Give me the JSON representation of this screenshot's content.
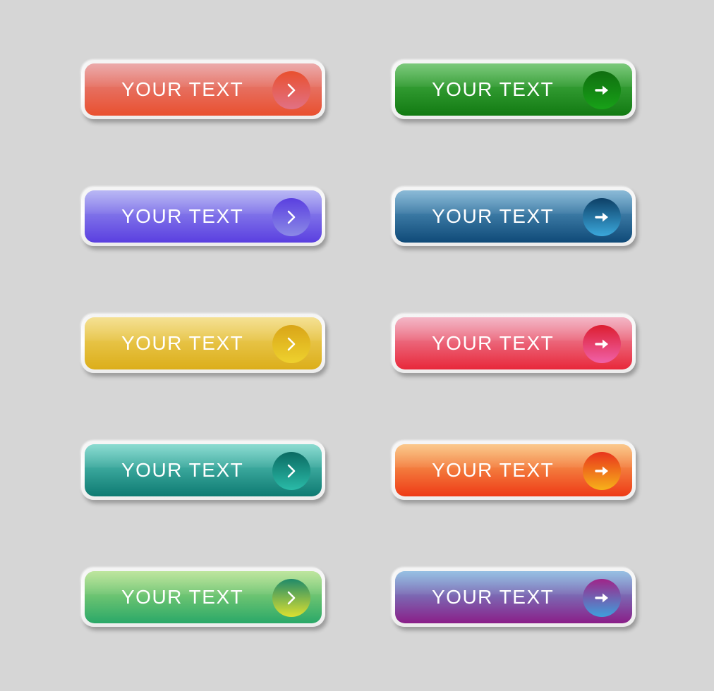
{
  "background": "#d6d6d6",
  "buttons": [
    {
      "label": "YOUR TEXT",
      "icon": "chevron-right",
      "top": "#e48a8a",
      "bottom": "#e9502f",
      "circle_top": "#e9502f",
      "circle_bottom": "#e17185"
    },
    {
      "label": "YOUR TEXT",
      "icon": "arrow-right",
      "top": "#4ab54a",
      "bottom": "#127a12",
      "circle_top": "#0f6e0f",
      "circle_bottom": "#18a118"
    },
    {
      "label": "YOUR TEXT",
      "icon": "chevron-right",
      "top": "#9e9cf0",
      "bottom": "#5a3fe0",
      "circle_top": "#5a3fe0",
      "circle_bottom": "#8b8ae6"
    },
    {
      "label": "YOUR TEXT",
      "icon": "arrow-right",
      "top": "#5fa0c8",
      "bottom": "#0f4a78",
      "circle_top": "#0d3f66",
      "circle_bottom": "#3ba8dc"
    },
    {
      "label": "YOUR TEXT",
      "icon": "chevron-right",
      "top": "#f0d56a",
      "bottom": "#dcae1a",
      "circle_top": "#d9a518",
      "circle_bottom": "#eed12e"
    },
    {
      "label": "YOUR TEXT",
      "icon": "arrow-right",
      "top": "#ee9ab0",
      "bottom": "#e8283a",
      "circle_top": "#dc1e30",
      "circle_bottom": "#f061a8"
    },
    {
      "label": "YOUR TEXT",
      "icon": "chevron-right",
      "top": "#5fcdbf",
      "bottom": "#0e7a72",
      "circle_top": "#0b6a62",
      "circle_bottom": "#2abba8"
    },
    {
      "label": "YOUR TEXT",
      "icon": "arrow-right",
      "top": "#f8b460",
      "bottom": "#ee3a16",
      "circle_top": "#e8341c",
      "circle_bottom": "#f7b21a"
    },
    {
      "label": "YOUR TEXT",
      "icon": "chevron-right",
      "top": "#a6dc7a",
      "bottom": "#2aa868",
      "circle_top": "#1f8a6a",
      "circle_bottom": "#dde030"
    },
    {
      "label": "YOUR TEXT",
      "icon": "arrow-right",
      "top": "#6fa8d8",
      "bottom": "#8a1e88",
      "circle_top": "#a02488",
      "circle_bottom": "#3ea0dc"
    }
  ]
}
